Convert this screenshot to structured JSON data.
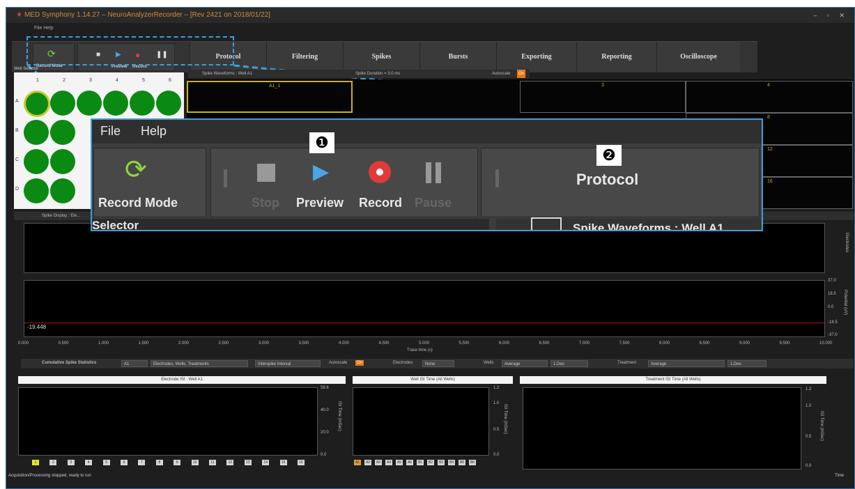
{
  "window": {
    "title": "MED Symphony 1.14.27 – NeuroAnalyzerRecorder – [Rev 2421 on 2018/01/22]",
    "controls": "– ▫ ✕"
  },
  "menu_small": "File   Help",
  "ribbon": {
    "record_mode_label": "Record Mode",
    "preview_label": "Preview",
    "record_label": "Record",
    "tabs": [
      "Protocol",
      "Filtering",
      "Spikes",
      "Bursts",
      "Exporting",
      "Reporting",
      "Oscilloscope"
    ]
  },
  "well_selector": {
    "caption": "Well Selector",
    "columns": [
      "1",
      "2",
      "3",
      "4",
      "5",
      "6"
    ],
    "rows": [
      "A",
      "B",
      "C",
      "D"
    ]
  },
  "spike_waveforms": {
    "title": "Spike Waveforms : Well A1",
    "duration": "Spike Duration = 3.0 ms",
    "autoscale": "Autoscale",
    "autoscale_state": "On",
    "cell_labels": [
      "A1_1",
      "3",
      "4",
      "8",
      "12",
      "16"
    ]
  },
  "spike_display": {
    "title": "Spike Display : Ele..."
  },
  "trace": {
    "value_label": "-19.448",
    "y_ticks": [
      "37.0",
      "18.5",
      "0.0",
      "-18.5",
      "-37.0"
    ],
    "y_label": "Potential (uV)",
    "x_ticks": [
      "0.000",
      "0.500",
      "1.000",
      "1.500",
      "2.000",
      "2.500",
      "3.000",
      "3.500",
      "4.000",
      "4.500",
      "5.000",
      "5.500",
      "6.000",
      "6.500",
      "7.000",
      "7.500",
      "8.000",
      "8.500",
      "9.000",
      "9.500",
      "10.000"
    ],
    "x_label": "Trace time (s)",
    "electrodes_label": "Electrodes"
  },
  "cumulative": {
    "title": "Cumulative Spike Statistics",
    "well": "A1",
    "group": "Electrodes, Wells, Treatments",
    "metric": "Interspike Interval",
    "autoscale": "Autoscale",
    "autoscale_state": "On",
    "electrodes_label": "Electrodes",
    "electrodes_value": "None",
    "wells_label": "Wells",
    "wells_value": "Average",
    "wells_stat": "1.Dev.",
    "treatment_label": "Treatment",
    "treatment_value": "Average",
    "treatment_stat": "1.Dev."
  },
  "charts": {
    "electrode": {
      "title": "Electrode ISI : Well A1",
      "y_ticks": [
        "58.6",
        "40.0",
        "20.0",
        "0.0"
      ],
      "y_label": "ISI Time (mSec)"
    },
    "well": {
      "title": "Well ISI Time (All Wells)",
      "y_ticks": [
        "1.2",
        "1.0",
        "0.5",
        "0.0"
      ],
      "y_label": "ISI Time (mSec)"
    },
    "treatment": {
      "title": "Treatment ISI Time (All Wells)",
      "y_ticks": [
        "1.2",
        "1.0",
        "0.5",
        "0.0"
      ],
      "y_label": "ISI Time (mSec)"
    },
    "electrode_chips": [
      "1",
      "2",
      "3",
      "4",
      "5",
      "6",
      "7",
      "8",
      "9",
      "10",
      "11",
      "12",
      "13",
      "14",
      "15",
      "16"
    ],
    "well_chips": [
      "A1",
      "A2",
      "A3",
      "A4",
      "A5",
      "A6",
      "B1",
      "B2",
      "B3",
      "B4",
      "B5",
      "B6"
    ]
  },
  "status": {
    "text": "Acquisition/Processing stopped, ready to run",
    "right": "Time"
  },
  "zoom": {
    "menu": [
      "File",
      "Help"
    ],
    "record_mode": "Record Mode",
    "stop": "Stop",
    "preview": "Preview",
    "record": "Record",
    "pause": "Pause",
    "protocol": "Protocol",
    "badge1": "❶",
    "badge2": "❷",
    "selector": "Selector",
    "spike_waveforms": "Spike Waveforms : Well A1"
  },
  "colors": {
    "accent": "#3aa0dd",
    "well_green": "#0a8a12",
    "on_orange": "#e07a1a"
  }
}
